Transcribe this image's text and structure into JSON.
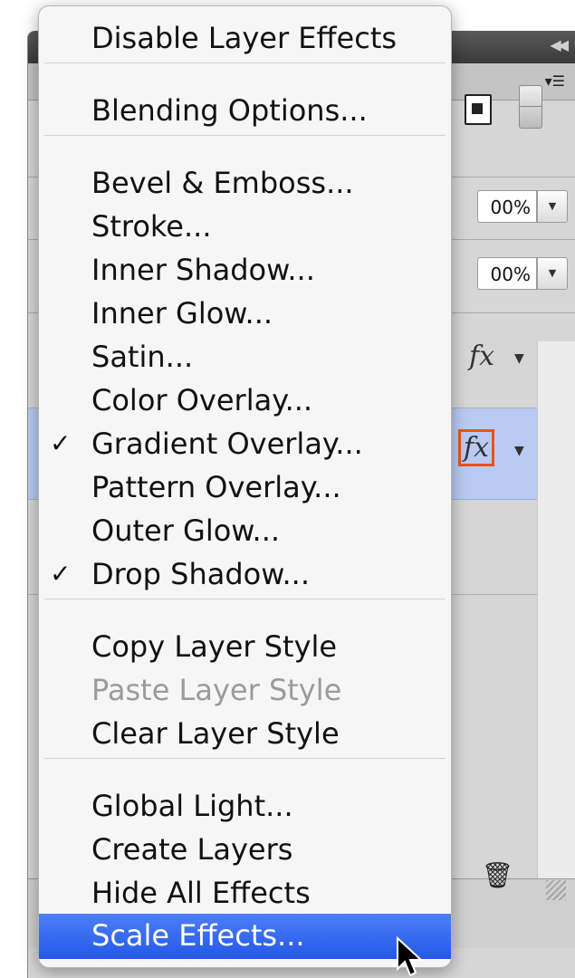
{
  "panel": {
    "opacity_value": "00%",
    "fill_value": "00%",
    "fx_label": "fx",
    "icons": [
      "collapse-icon",
      "panel-menu-icon",
      "new-doc-icon",
      "lock-icon",
      "dropdown-arrow-icon",
      "trash-icon",
      "resize-grip-icon"
    ],
    "colors": {
      "selected_layer": "#b9cbf2",
      "highlight_outline": "#e8541a"
    }
  },
  "menu": {
    "groups": [
      [
        {
          "label": "Disable Layer Effects"
        }
      ],
      [
        {
          "label": "Blending Options..."
        }
      ],
      [
        {
          "label": "Bevel & Emboss..."
        },
        {
          "label": "Stroke..."
        },
        {
          "label": "Inner Shadow..."
        },
        {
          "label": "Inner Glow..."
        },
        {
          "label": "Satin..."
        },
        {
          "label": "Color Overlay..."
        },
        {
          "label": "Gradient Overlay...",
          "checked": true
        },
        {
          "label": "Pattern Overlay..."
        },
        {
          "label": "Outer Glow..."
        },
        {
          "label": "Drop Shadow...",
          "checked": true
        }
      ],
      [
        {
          "label": "Copy Layer Style"
        },
        {
          "label": "Paste Layer Style",
          "disabled": true
        },
        {
          "label": "Clear Layer Style"
        }
      ],
      [
        {
          "label": "Global Light..."
        },
        {
          "label": "Create Layers"
        },
        {
          "label": "Hide All Effects"
        },
        {
          "label": "Scale Effects...",
          "selected": true
        }
      ]
    ],
    "check_glyph": "✓",
    "colors": {
      "selected_bg": "#2f63ee",
      "disabled_text": "#9b9b9b"
    }
  }
}
